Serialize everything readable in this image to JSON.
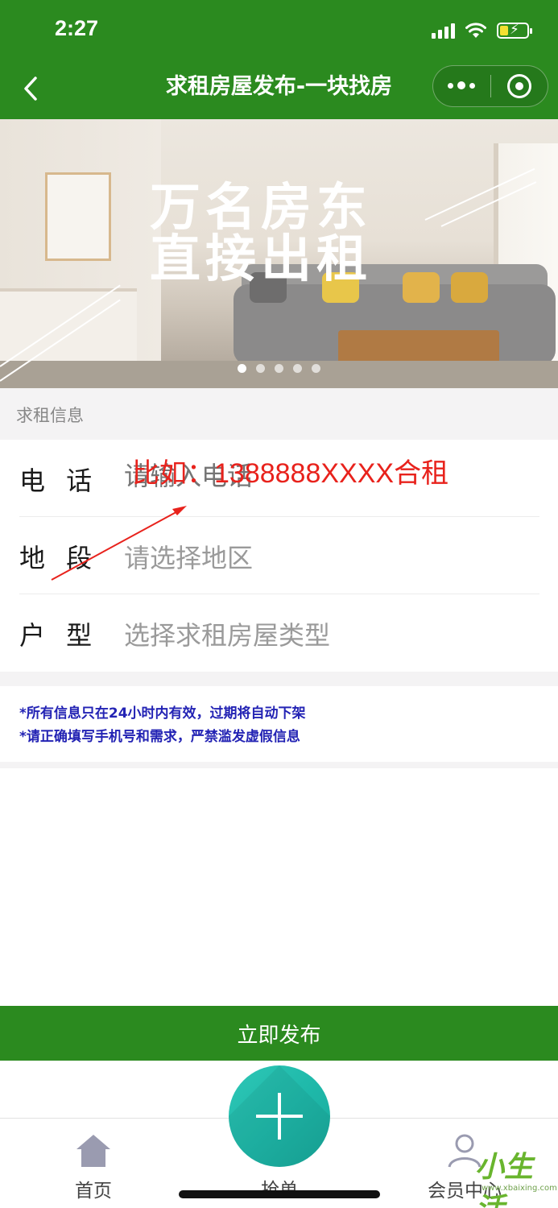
{
  "status_bar": {
    "time": "2:27"
  },
  "nav": {
    "title": "求租房屋发布-一块找房"
  },
  "banner": {
    "headline_line1": "万名房东",
    "headline_line2": "直接出租",
    "slide_count": 5,
    "active_slide": 1
  },
  "section": {
    "title": "求租信息"
  },
  "form": {
    "phone": {
      "label": "电 话",
      "placeholder": "请输入电话"
    },
    "area": {
      "label": "地 段",
      "placeholder": "请选择地区"
    },
    "type": {
      "label": "户 型",
      "placeholder": "选择求租房屋类型"
    }
  },
  "annotation": {
    "text": "比如：1388888XXXX合租",
    "color": "#e8221c"
  },
  "notes": [
    "*所有信息只在24小时内有效，过期将自动下架",
    "*请正确填写手机号和需求，严禁滥发虚假信息"
  ],
  "publish_button": "立即发布",
  "tabbar": {
    "home": "首页",
    "grab": "抢单",
    "member": "会员中心"
  },
  "watermark": {
    "text": "小生活",
    "url": "www.xbaixing.com"
  },
  "colors": {
    "brand_green": "#2b8a1f",
    "fab_teal": "#1fb9aa",
    "note_blue": "#2323b4"
  }
}
